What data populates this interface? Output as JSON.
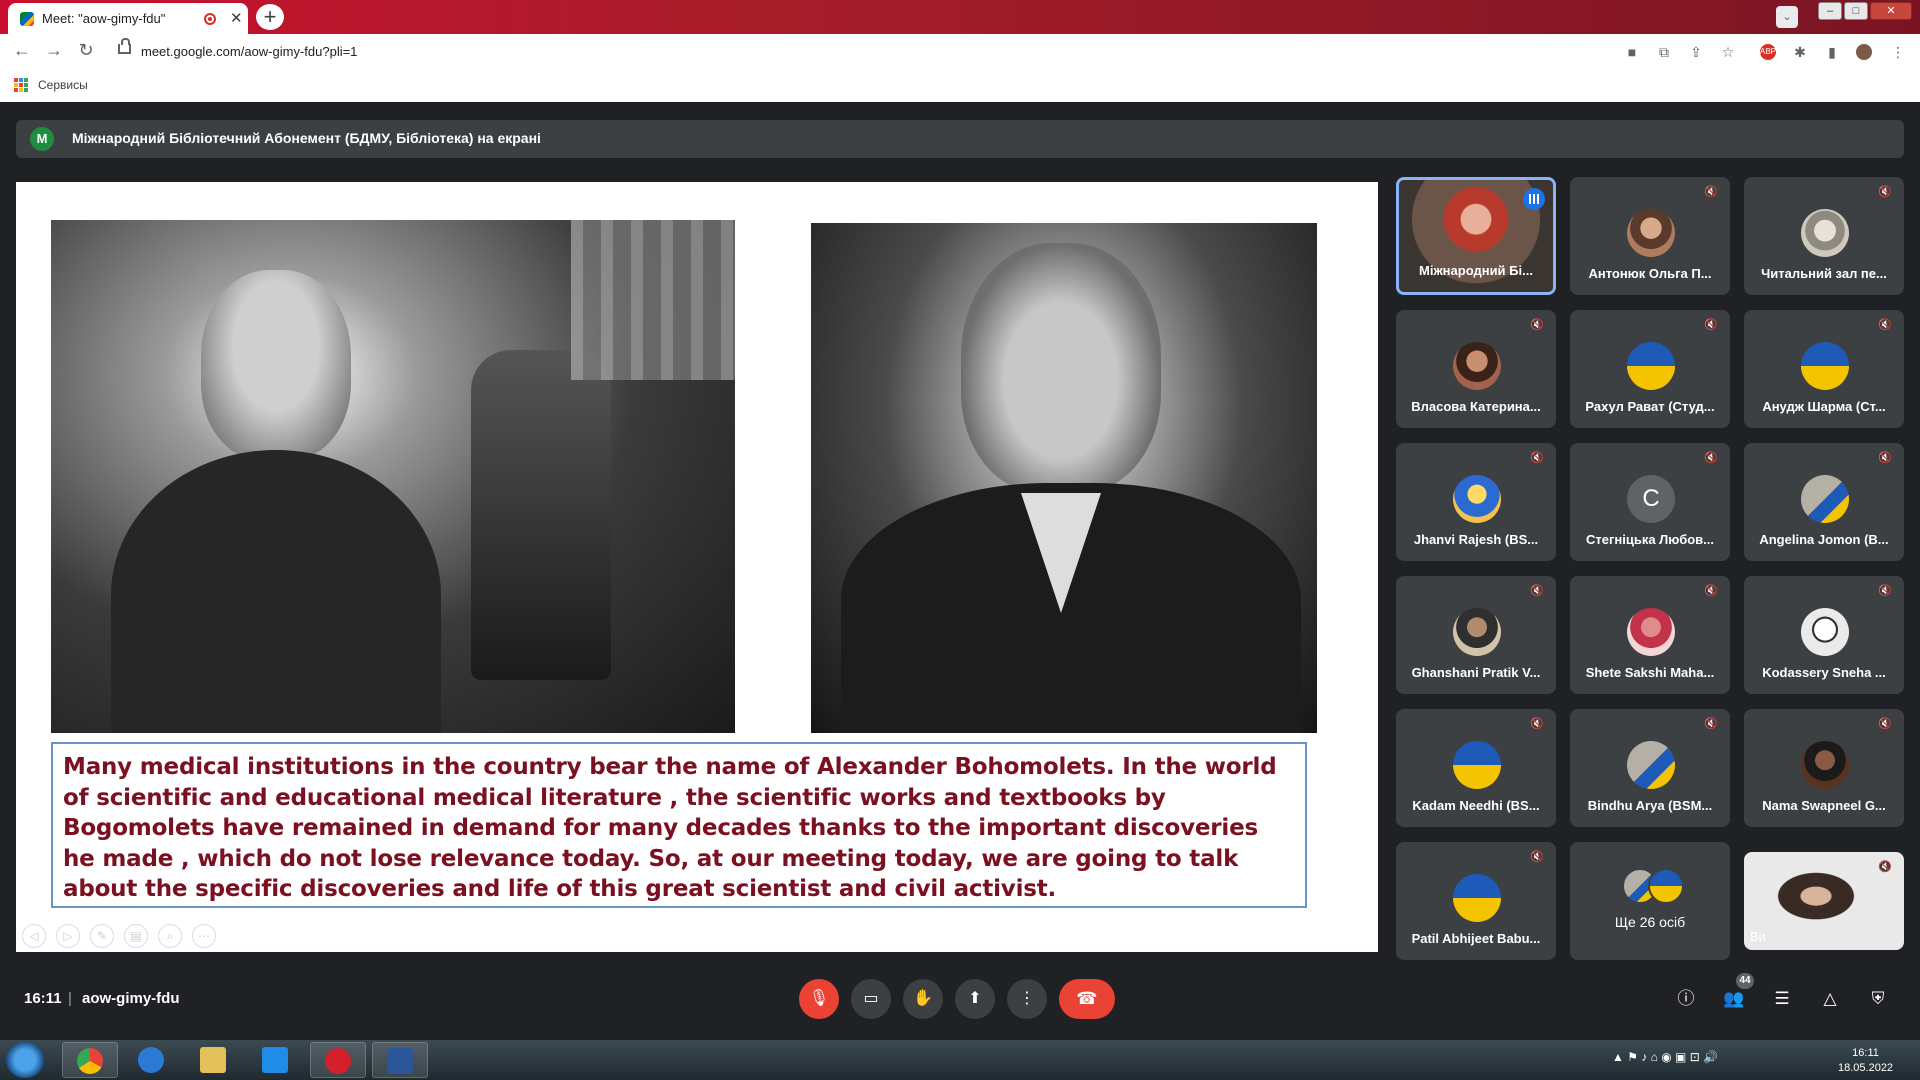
{
  "browser": {
    "tab_title": "Meet: \"aow-gimy-fdu\"",
    "url": "meet.google.com/aow-gimy-fdu?pli=1",
    "bookmark_label": "Сервисы",
    "new_tab_icon": "plus-icon",
    "accent": "#c8102e"
  },
  "meet": {
    "presenter_initial": "M",
    "presenter_text": "Міжнародний Бібліотечний Абонемент (БДМУ, Бібліотека) на екрані",
    "slide_caption": "Many medical institutions in the country bear the name of Alexander Bohomolets. In the world of scientific and educational medical literature , the scientific works and textbooks by Bogomolets have remained in demand for many decades thanks to the important discoveries he made , which do not lose relevance today. So, at our meeting today, we are going to talk about the specific discoveries and life of this great scientist and civil activist.",
    "caption_color": "#7a1020",
    "participants": [
      {
        "name": "Міжнародний Бі...",
        "muted": false,
        "speaking": true
      },
      {
        "name": "Антонюк Ольга П...",
        "muted": true
      },
      {
        "name": "Читальний зал пе...",
        "muted": true
      },
      {
        "name": "Власова Катерина...",
        "muted": true
      },
      {
        "name": "Рахул Рават (Студ...",
        "muted": true
      },
      {
        "name": "Анудж Шарма (Ст...",
        "muted": true
      },
      {
        "name": "Jhanvi Rajesh (BS...",
        "muted": true
      },
      {
        "name": "Стегніцька Любов...",
        "muted": true,
        "initial": "C"
      },
      {
        "name": "Angelina Jomon (B...",
        "muted": true
      },
      {
        "name": "Ghanshani Pratik V...",
        "muted": true
      },
      {
        "name": "Shete Sakshi Maha...",
        "muted": true
      },
      {
        "name": "Kodassery Sneha ...",
        "muted": true
      },
      {
        "name": "Kadam Needhi (BS...",
        "muted": true
      },
      {
        "name": "Bindhu Arya (BSM...",
        "muted": true
      },
      {
        "name": "Nama Swapneel G...",
        "muted": true
      },
      {
        "name": "Patil Abhijeet Babu...",
        "muted": true
      },
      {
        "name": "Ще 26 осіб",
        "muted": false
      },
      {
        "name": "Ви",
        "muted": true
      }
    ],
    "time": "16:11",
    "meeting_code": "aow-gimy-fdu",
    "people_count": "44",
    "end_call_color": "#ea4335"
  },
  "taskbar": {
    "clock_time": "16:11",
    "clock_date": "18.05.2022"
  }
}
